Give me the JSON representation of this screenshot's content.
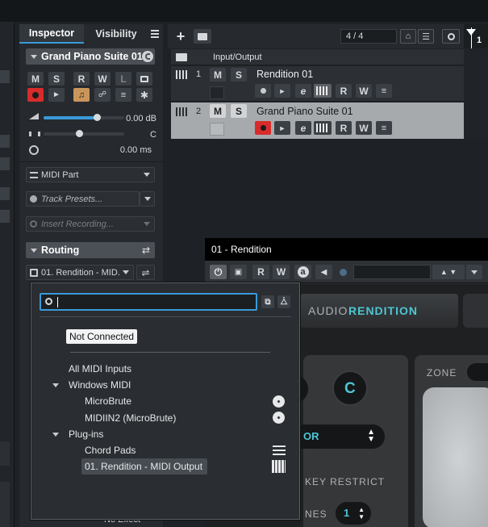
{
  "inspector": {
    "tab_inspector": "Inspector",
    "tab_visibility": "Visibility",
    "track_name": "Grand Piano Suite 01",
    "buttons": {
      "mute": "M",
      "solo": "S",
      "read": "R",
      "write": "W",
      "lanes": "L"
    },
    "volume": "0.00 dB",
    "pan": "C",
    "delay": "0.00 ms",
    "midi_part": "MIDI Part",
    "track_presets": "Track Presets...",
    "insert_recording": "Insert Recording...",
    "routing_label": "Routing",
    "routing_value": "01. Rendition - MID.",
    "no_effect": "No Effect"
  },
  "tracklist": {
    "counter": "4 / 4",
    "folder_label": "Input/Output",
    "ruler_marker": "1",
    "tracks": [
      {
        "number": "1",
        "name": "Rendition 01",
        "mute": "M",
        "solo": "S",
        "read": "R",
        "write": "W"
      },
      {
        "number": "2",
        "name": "Grand Piano Suite 01",
        "mute": "M",
        "solo": "S",
        "read": "R",
        "write": "W"
      }
    ]
  },
  "plugin_window": {
    "title": "01 - Rendition",
    "read": "R",
    "write": "W",
    "auto_btn": "a",
    "brand_prefix": "AUDIO ",
    "brand_name": "RENDITION",
    "key_label": "C",
    "zone_label": "ZONE",
    "select_value": "OR",
    "key_restrict": "KEY RESTRICT",
    "tones_label": "NES",
    "tones_value": "1"
  },
  "dropdown": {
    "search_value": "",
    "items": {
      "not_connected": "Not Connected",
      "all_midi_inputs": "All MIDI Inputs",
      "windows_midi": "Windows MIDI",
      "microbrute": "MicroBrute",
      "midiin2": "MIDIIN2 (MicroBrute)",
      "plugins": "Plug-ins",
      "chord_pads": "Chord Pads",
      "rendition_output": "01. Rendition - MIDI Output"
    }
  },
  "colors": {
    "accent_blue": "#3a9ad9",
    "record_red": "#d92b2b",
    "monitor_orange": "#c9955a",
    "brand_teal": "#4ec6d3"
  }
}
